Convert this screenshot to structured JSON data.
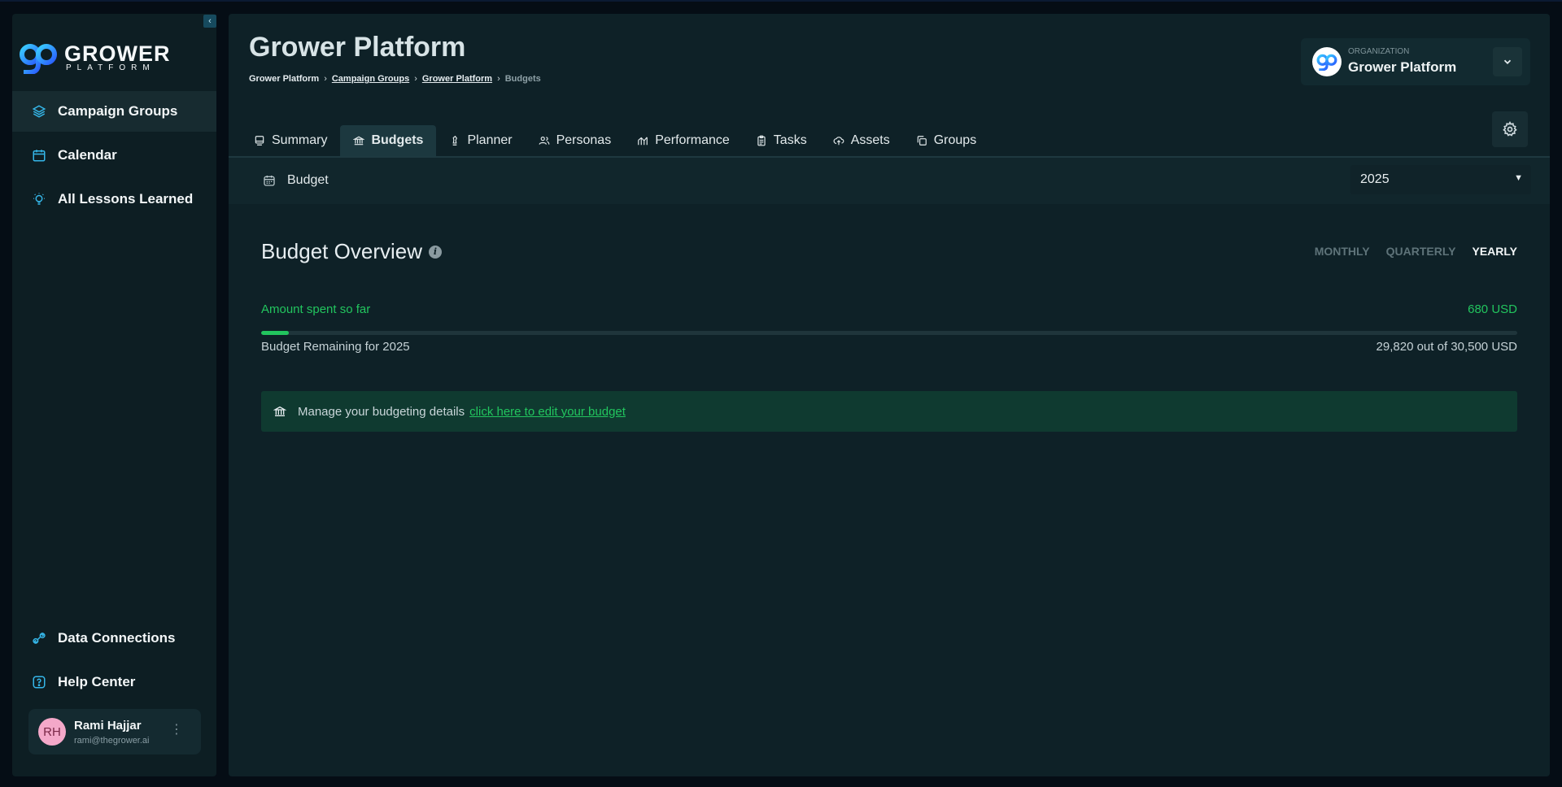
{
  "sidebar": {
    "logo": {
      "word": "GROWER",
      "sub": "PLATFORM"
    },
    "collapse_icon": "chevron-left-icon",
    "items": [
      {
        "label": "Campaign Groups",
        "icon": "layers-icon",
        "active": true
      },
      {
        "label": "Calendar",
        "icon": "calendar-icon",
        "active": false
      },
      {
        "label": "All Lessons Learned",
        "icon": "lightbulb-icon",
        "active": false
      }
    ],
    "bottom_items": [
      {
        "label": "Data Connections",
        "icon": "link-icon"
      },
      {
        "label": "Help Center",
        "icon": "help-icon"
      }
    ],
    "user": {
      "initials": "RH",
      "name": "Rami Hajjar",
      "email": "rami@thegrower.ai"
    }
  },
  "header": {
    "title": "Grower Platform",
    "breadcrumb": [
      {
        "label": "Grower Platform",
        "link": false
      },
      {
        "label": "Campaign Groups",
        "link": true
      },
      {
        "label": "Grower Platform",
        "link": true
      },
      {
        "label": "Budgets",
        "link": false
      }
    ],
    "breadcrumb_separator": "›",
    "organization": {
      "label": "ORGANIZATION",
      "name": "Grower Platform"
    }
  },
  "tabs": [
    {
      "label": "Summary",
      "icon": "summary-icon",
      "active": false
    },
    {
      "label": "Budgets",
      "icon": "bank-icon",
      "active": true
    },
    {
      "label": "Planner",
      "icon": "chess-icon",
      "active": false
    },
    {
      "label": "Personas",
      "icon": "users-icon",
      "active": false
    },
    {
      "label": "Performance",
      "icon": "chart-icon",
      "active": false
    },
    {
      "label": "Tasks",
      "icon": "clipboard-icon",
      "active": false
    },
    {
      "label": "Assets",
      "icon": "upload-cloud-icon",
      "active": false
    },
    {
      "label": "Groups",
      "icon": "copy-icon",
      "active": false
    }
  ],
  "budget_bar": {
    "label": "Budget",
    "year": "2025"
  },
  "overview": {
    "title": "Budget Overview",
    "info_icon": "i",
    "periods": [
      {
        "label": "MONTHLY",
        "active": false
      },
      {
        "label": "QUARTERLY",
        "active": false
      },
      {
        "label": "YEARLY",
        "active": true
      }
    ],
    "spent_label": "Amount spent so far",
    "spent_value": "680 USD",
    "progress_percent": 2.2,
    "remaining_label": "Budget Remaining for 2025",
    "remaining_value": "29,820 out of 30,500 USD",
    "manage_text": "Manage your budgeting details",
    "manage_link": "click here to edit your budget"
  },
  "colors": {
    "accent_green": "#22c55e",
    "accent_blue": "#35b6e8",
    "panel": "#0e2127",
    "sidebar": "#0d1e23"
  }
}
